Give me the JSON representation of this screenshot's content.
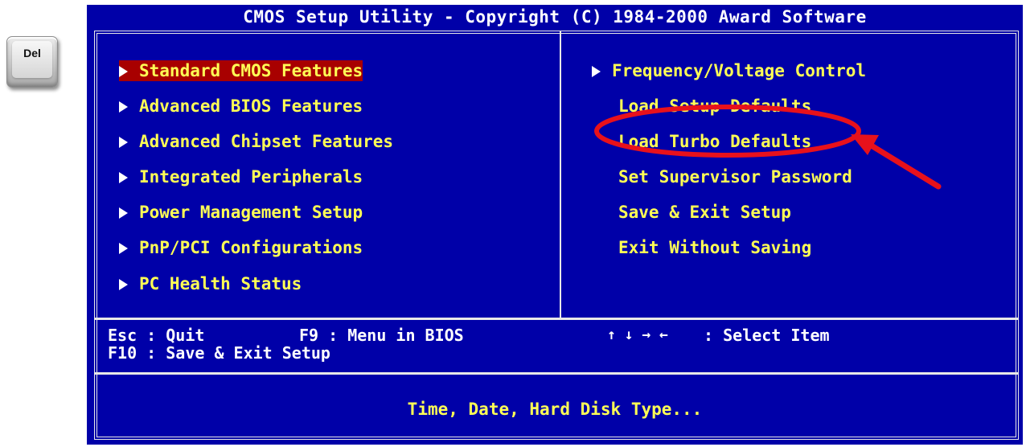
{
  "del_key": {
    "label": "Del"
  },
  "bios": {
    "title": "CMOS Setup Utility - Copyright (C) 1984-2000 Award Software",
    "left_menu": [
      {
        "label": "Standard CMOS Features",
        "selected": true
      },
      {
        "label": "Advanced BIOS Features"
      },
      {
        "label": "Advanced Chipset Features"
      },
      {
        "label": "Integrated Peripherals"
      },
      {
        "label": "Power Management Setup"
      },
      {
        "label": "PnP/PCI Configurations"
      },
      {
        "label": "PC Health Status"
      }
    ],
    "right_menu": [
      {
        "label": "Frequency/Voltage Control",
        "has_submenu": true
      },
      {
        "label": "Load Setup Defaults"
      },
      {
        "label": "Load Turbo Defaults"
      },
      {
        "label": "Set Supervisor Password"
      },
      {
        "label": "Save & Exit Setup"
      },
      {
        "label": "Exit Without Saving"
      }
    ],
    "help": {
      "esc_key": "Esc : Quit",
      "f9_key": "F9 : Menu in BIOS",
      "arrows": "↑ ↓ → ←",
      "select_item": ": Select Item",
      "f10_key": "F10 : Save & Exit Setup"
    },
    "status": "Time, Date, Hard Disk Type..."
  },
  "annotation": {
    "color": "#e8111b"
  }
}
